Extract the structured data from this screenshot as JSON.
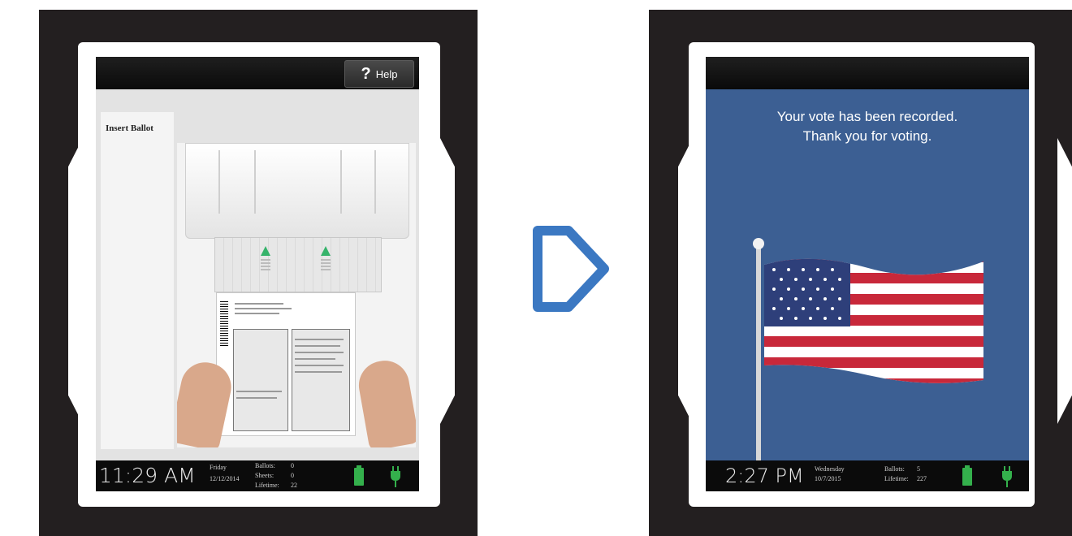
{
  "left_screen": {
    "help_label": "Help",
    "help_icon": "question-mark",
    "panel_title": "Insert Ballot",
    "clock": "11:29 AM",
    "day": "Friday",
    "date": "12/12/2014",
    "ballots_label": "Ballots:",
    "ballots_value": "0",
    "sheets_label": "Sheets:",
    "sheets_value": "0",
    "lifetime_label": "Lifetime:",
    "lifetime_value": "22",
    "battery_icon": "battery-full",
    "power_icon": "plug",
    "accent_green": "#34b04c"
  },
  "right_screen": {
    "message_line1": "Your vote has been recorded.",
    "message_line2": "Thank you for voting.",
    "clock": "2:27 PM",
    "day": "Wednesday",
    "date": "10/7/2015",
    "ballots_label": "Ballots:",
    "ballots_value": "5",
    "lifetime_label": "Lifetime:",
    "lifetime_value": "227",
    "battery_icon": "battery-full",
    "power_icon": "plug",
    "background_color": "#3c5f93"
  },
  "transition_icon": "chevron-right-outline",
  "arrow_color": "#3b78c2"
}
